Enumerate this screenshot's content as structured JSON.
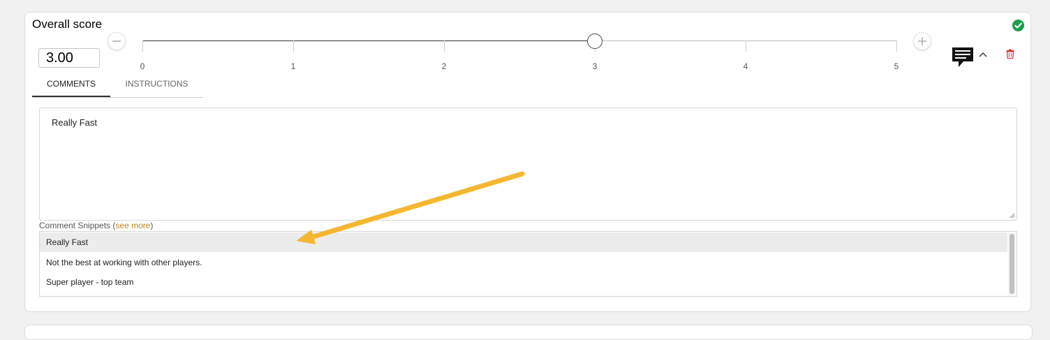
{
  "card": {
    "title": "Overall score"
  },
  "score": {
    "value": "3.00",
    "min": 0,
    "max": 5,
    "current": 3,
    "ticks": [
      "0",
      "1",
      "2",
      "3",
      "4",
      "5"
    ]
  },
  "tabs": [
    {
      "label": "COMMENTS",
      "active": true
    },
    {
      "label": "INSTRUCTIONS",
      "active": false
    }
  ],
  "comment": {
    "text": "Really Fast"
  },
  "snippets": {
    "label_prefix": "Comment Snippets (",
    "link_text": "see more",
    "label_suffix": ")",
    "items": [
      {
        "text": "Really Fast",
        "selected": true
      },
      {
        "text": "Not the best at working with other players.",
        "selected": false
      },
      {
        "text": "Super player - top team",
        "selected": false
      }
    ]
  },
  "icons": {
    "status": "check-circle-icon",
    "decrement": "minus-icon",
    "increment": "plus-icon",
    "comment": "comment-icon",
    "collapse": "chevron-up-icon",
    "delete": "trash-icon"
  },
  "colors": {
    "success": "#1e9e4c",
    "danger": "#e53935",
    "link": "#c0871e",
    "annotation_arrow": "#f5b731"
  }
}
